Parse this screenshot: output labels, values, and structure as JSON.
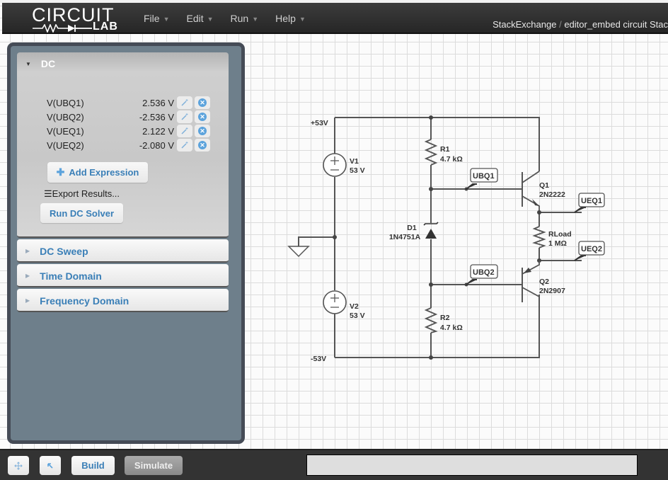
{
  "header": {
    "logo_top": "CIRCUIT",
    "logo_bottom": "LAB",
    "menu": [
      {
        "label": "File"
      },
      {
        "label": "Edit"
      },
      {
        "label": "Run"
      },
      {
        "label": "Help"
      }
    ],
    "breadcrumb": {
      "owner": "StackExchange",
      "separator": "/",
      "title": "editor_embed circuit Stac"
    }
  },
  "sidebar": {
    "dc": {
      "title": "DC",
      "expressions": [
        {
          "name": "V(UBQ1)",
          "value": "2.536 V"
        },
        {
          "name": "V(UBQ2)",
          "value": "-2.536 V"
        },
        {
          "name": "V(UEQ1)",
          "value": "2.122 V"
        },
        {
          "name": "V(UEQ2)",
          "value": "-2.080 V"
        }
      ],
      "add_expression_label": "Add Expression",
      "export_label": "Export Results...",
      "run_label": "Run DC Solver"
    },
    "sections": [
      {
        "title": "DC Sweep"
      },
      {
        "title": "Time Domain"
      },
      {
        "title": "Frequency Domain"
      }
    ]
  },
  "schematic": {
    "rails": {
      "positive": "+53V",
      "negative": "-53V"
    },
    "components": {
      "V1": {
        "name": "V1",
        "value": "53 V"
      },
      "V2": {
        "name": "V2",
        "value": "53 V"
      },
      "R1": {
        "name": "R1",
        "value": "4.7 kΩ"
      },
      "R2": {
        "name": "R2",
        "value": "4.7 kΩ"
      },
      "RLoad": {
        "name": "RLoad",
        "value": "1 MΩ"
      },
      "D1": {
        "name": "D1",
        "value": "1N4751A"
      },
      "Q1": {
        "name": "Q1",
        "value": "2N2222"
      },
      "Q2": {
        "name": "Q2",
        "value": "2N2907"
      }
    },
    "net_labels": {
      "UBQ1": "UBQ1",
      "UBQ2": "UBQ2",
      "UEQ1": "UEQ1",
      "UEQ2": "UEQ2"
    }
  },
  "bottombar": {
    "build_label": "Build",
    "simulate_label": "Simulate",
    "status_text": ""
  },
  "colors": {
    "accent": "#3a7fb7",
    "panel_bg": "#6e7f8b",
    "panel_border": "#454b56",
    "delete_icon": "#5ca3dc"
  }
}
